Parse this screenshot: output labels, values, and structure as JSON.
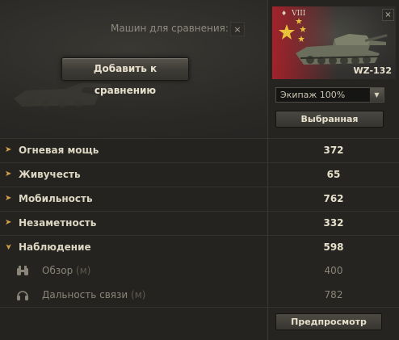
{
  "compare": {
    "label": "Машин для сравнения:",
    "count": "1",
    "close_glyph": "×",
    "add_button": "Добавить к сравнению"
  },
  "vehicle": {
    "tier": "VIII",
    "nation_icon": "china-flag-icon",
    "name": "WZ-132",
    "close_glyph": "×",
    "crew_select_value": "Экипаж 100%",
    "favorite_button": "Выбранная"
  },
  "stats": [
    {
      "label": "Огневая мощь",
      "value": "372",
      "expanded": false
    },
    {
      "label": "Живучесть",
      "value": "65",
      "expanded": false
    },
    {
      "label": "Мобильность",
      "value": "762",
      "expanded": false
    },
    {
      "label": "Незаметность",
      "value": "332",
      "expanded": false
    },
    {
      "label": "Наблюдение",
      "value": "598",
      "expanded": true
    }
  ],
  "sub_stats": [
    {
      "label": "Обзор",
      "unit": "(м)",
      "value": "400",
      "icon": "binoculars-icon"
    },
    {
      "label": "Дальность связи",
      "unit": "(м)",
      "value": "782",
      "icon": "headphones-icon"
    }
  ],
  "preview_button": "Предпросмотр",
  "colors": {
    "background": "#242320",
    "chevron": "#d4a24a",
    "flag_red": "#b8202a",
    "flag_star": "#e8c23a"
  }
}
